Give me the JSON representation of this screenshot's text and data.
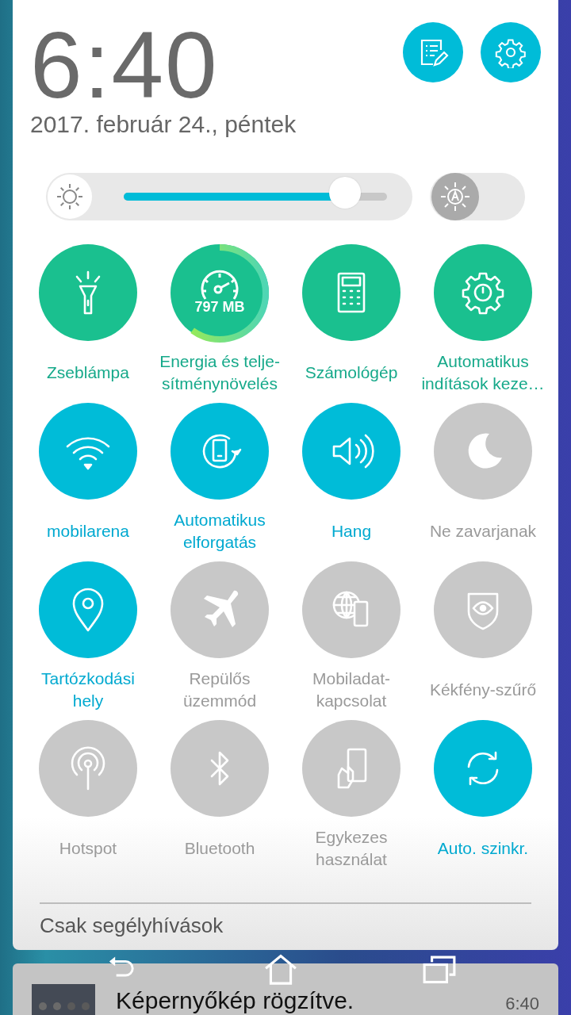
{
  "clock": {
    "time": "6:40",
    "date": "2017. február 24., péntek"
  },
  "header_buttons": [
    {
      "kind": "edit"
    },
    {
      "kind": "settings"
    }
  ],
  "brightness": {
    "level": 0.84,
    "auto": false
  },
  "tiles": [
    {
      "kind": "shortcut",
      "label": "Zseblámpa"
    },
    {
      "kind": "booster",
      "label": "Energia és telje-\nsítménynövelés",
      "reading": "797 MB"
    },
    {
      "kind": "shortcut",
      "label": "Számológép"
    },
    {
      "kind": "shortcut",
      "label": "Automatikus\nindítások keze…"
    },
    {
      "kind": "toggle",
      "label": "mobilarena",
      "on": true
    },
    {
      "kind": "toggle",
      "label": "Automatikus\nelforgatás",
      "on": true
    },
    {
      "kind": "toggle",
      "label": "Hang",
      "on": true
    },
    {
      "kind": "toggle",
      "label": "Ne zavarjanak",
      "on": false
    },
    {
      "kind": "toggle",
      "label": "Tartózkodási\nhely",
      "on": true
    },
    {
      "kind": "toggle",
      "label": "Repülős\nüzemmód",
      "on": false
    },
    {
      "kind": "toggle",
      "label": "Mobiladat-\nkapcsolat",
      "on": false
    },
    {
      "kind": "toggle",
      "label": "Kékfény-szűrő",
      "on": false
    },
    {
      "kind": "toggle",
      "label": "Hotspot",
      "on": false
    },
    {
      "kind": "toggle",
      "label": "Bluetooth",
      "on": false
    },
    {
      "kind": "toggle",
      "label": "Egykezes\nhasználat",
      "on": false
    },
    {
      "kind": "toggle",
      "label": "Auto. szinkr.",
      "on": true
    }
  ],
  "carrier_status": "Csak segélyhívások",
  "notification": {
    "title": "Képernyőkép rögzítve.",
    "time": "6:40"
  }
}
